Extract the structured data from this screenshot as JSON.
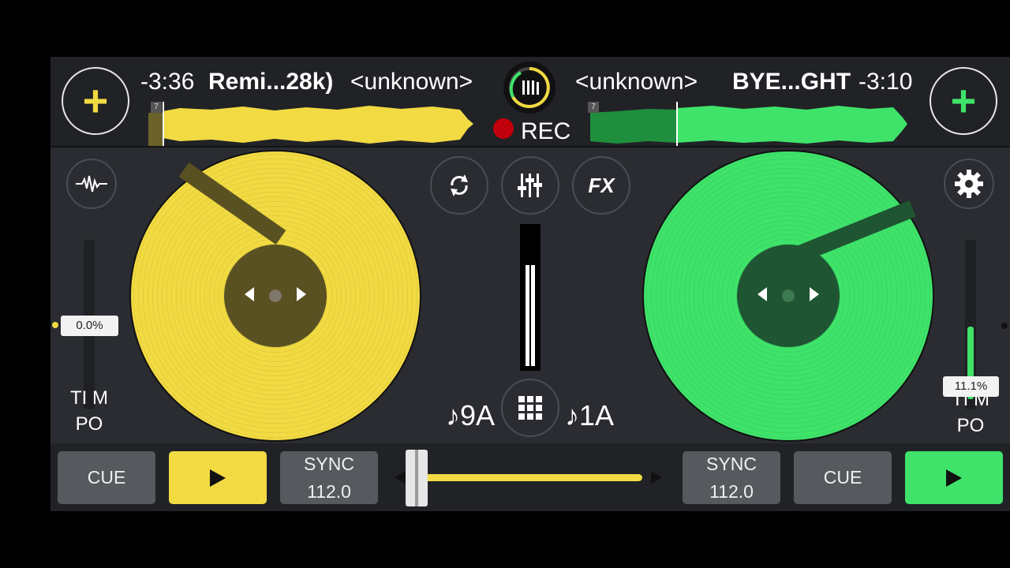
{
  "colors": {
    "deckA": "#f1da42",
    "deckB": "#3fe36a",
    "background": "#2a2c31",
    "record": "#c0000b"
  },
  "deckA": {
    "time_remaining": "-3:36",
    "title": "Remi...28k)",
    "artist": "<unknown>",
    "beat_marker": "7",
    "tempo_value": "0.0%",
    "tempo_label_line1": "TI M",
    "tempo_label_line2": "PO",
    "key": "♪9A",
    "cue_label": "CUE",
    "sync_label": "SYNC",
    "bpm": "112.0",
    "add_icon": "plus-icon"
  },
  "deckB": {
    "time_remaining": "-3:10",
    "title": "BYE...GHT",
    "artist": "<unknown>",
    "beat_marker": "7",
    "tempo_value": "11.1%",
    "tempo_label_line1": "TI M",
    "tempo_label_line2": "PO",
    "key": "♪1A",
    "cue_label": "CUE",
    "sync_label": "SYNC",
    "bpm": "112.0",
    "add_icon": "plus-icon"
  },
  "recording": {
    "label": "REC"
  },
  "center": {
    "loop_icon": "loop-icon",
    "mixer_icon": "mixer-sliders-icon",
    "fx_label": "FX",
    "grid_icon": "grid-icon",
    "library_icon": "library-icon"
  },
  "left_side": {
    "waveform_icon": "waveform-icon"
  },
  "right_side": {
    "settings_icon": "gear-icon"
  },
  "crossfader": {
    "position": 0.05
  },
  "tempo_fader_b": {
    "level": 0.111
  }
}
